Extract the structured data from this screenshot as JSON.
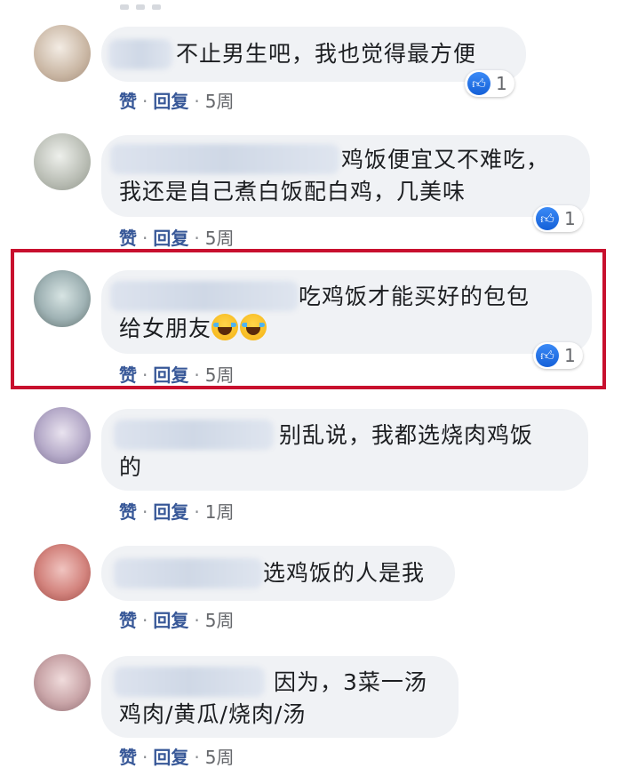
{
  "comments": [
    {
      "text": [
        "不止男生吧，我也觉得最方便"
      ],
      "actions": {
        "like": "赞",
        "reply": "回复",
        "time": "5周"
      },
      "likes": "1"
    },
    {
      "text": [
        "鸡饭便宜又不难吃，",
        "我还是自己煮白饭配白鸡，几美味"
      ],
      "actions": {
        "like": "赞",
        "reply": "回复",
        "time": "5周"
      },
      "likes": "1"
    },
    {
      "text": [
        "吃鸡饭才能买好的包包",
        "给女朋友"
      ],
      "actions": {
        "like": "赞",
        "reply": "回复",
        "time": "5周"
      },
      "likes": "1"
    },
    {
      "text": [
        "别乱说，我都选烧肉鸡饭",
        "的"
      ],
      "actions": {
        "like": "赞",
        "reply": "回复",
        "time": "1周"
      }
    },
    {
      "text": [
        "选鸡饭的人是我"
      ],
      "actions": {
        "like": "赞",
        "reply": "回复",
        "time": "5周"
      }
    },
    {
      "text": [
        "因为，3菜一汤",
        "鸡肉/黄瓜/烧肉/汤"
      ],
      "actions": {
        "like": "赞",
        "reply": "回复",
        "time": "5周"
      }
    }
  ],
  "icons": {
    "like": "thumbs-up-icon",
    "emoji": "tears-of-joy-emoji"
  },
  "colors": {
    "highlight": "#c8102e",
    "link": "#385898",
    "like_badge": "#1877f2",
    "bubble": "#f0f2f5"
  }
}
